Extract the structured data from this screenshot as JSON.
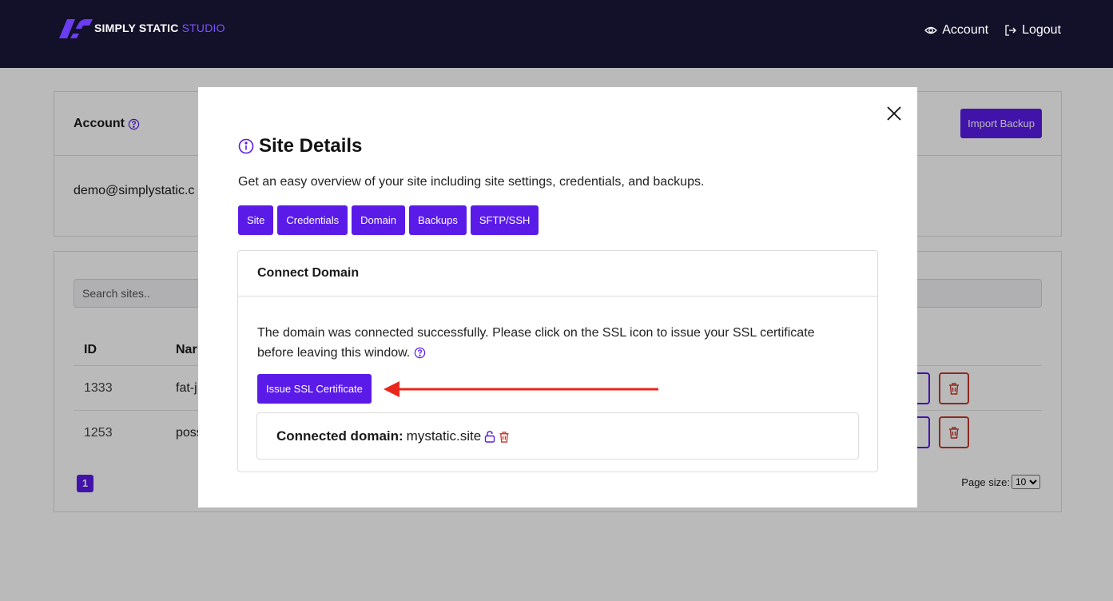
{
  "header": {
    "logo_text": "SIMPLY STATIC",
    "logo_accent": "STUDIO",
    "nav": [
      {
        "label": "Account",
        "icon": "eye-icon"
      },
      {
        "label": "Logout",
        "icon": "logout-icon"
      }
    ]
  },
  "account_card": {
    "title": "Account",
    "import_button": "Import Backup",
    "email": "demo@simplystatic.c"
  },
  "sites_card": {
    "search_placeholder": "Search sites..",
    "columns": [
      "ID",
      "Nar"
    ],
    "rows": [
      {
        "id": "1333",
        "name": "fat-j"
      },
      {
        "id": "1253",
        "name": "poss"
      }
    ],
    "page": "1",
    "page_size_label": "Page size:",
    "page_size_value": "10"
  },
  "modal": {
    "title": "Site Details",
    "description": "Get an easy overview of your site including site settings, credentials, and backups.",
    "tabs": [
      "Site",
      "Credentials",
      "Domain",
      "Backups",
      "SFTP/SSH"
    ],
    "panel": {
      "title": "Connect Domain",
      "message": "The domain was connected successfully. Please click on the SSL icon to issue your SSL certificate before leaving this window.",
      "ssl_button": "Issue SSL Certificate",
      "connected_label": "Connected domain:",
      "connected_domain": "mystatic.site"
    }
  },
  "colors": {
    "brand": "#5a1be8",
    "nav_bg": "#13102a",
    "danger": "#c0392b",
    "arrow": "#e8261b"
  }
}
